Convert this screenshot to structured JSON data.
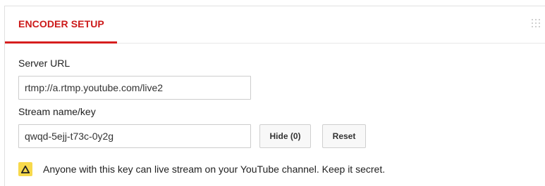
{
  "tab": {
    "label": "ENCODER SETUP"
  },
  "server": {
    "label": "Server URL",
    "value": "rtmp://a.rtmp.youtube.com/live2"
  },
  "stream": {
    "label": "Stream name/key",
    "value": "qwqd-5ejj-t73c-0y2g",
    "hide_label": "Hide (0)",
    "reset_label": "Reset"
  },
  "warning": {
    "text": "Anyone with this key can live stream on your YouTube channel. Keep it secret."
  },
  "colors": {
    "accent": "#cc1a1a",
    "warning_bg": "#f7d94c"
  },
  "icons": {
    "drag": "drag-grid-icon",
    "warning": "warning-icon"
  }
}
